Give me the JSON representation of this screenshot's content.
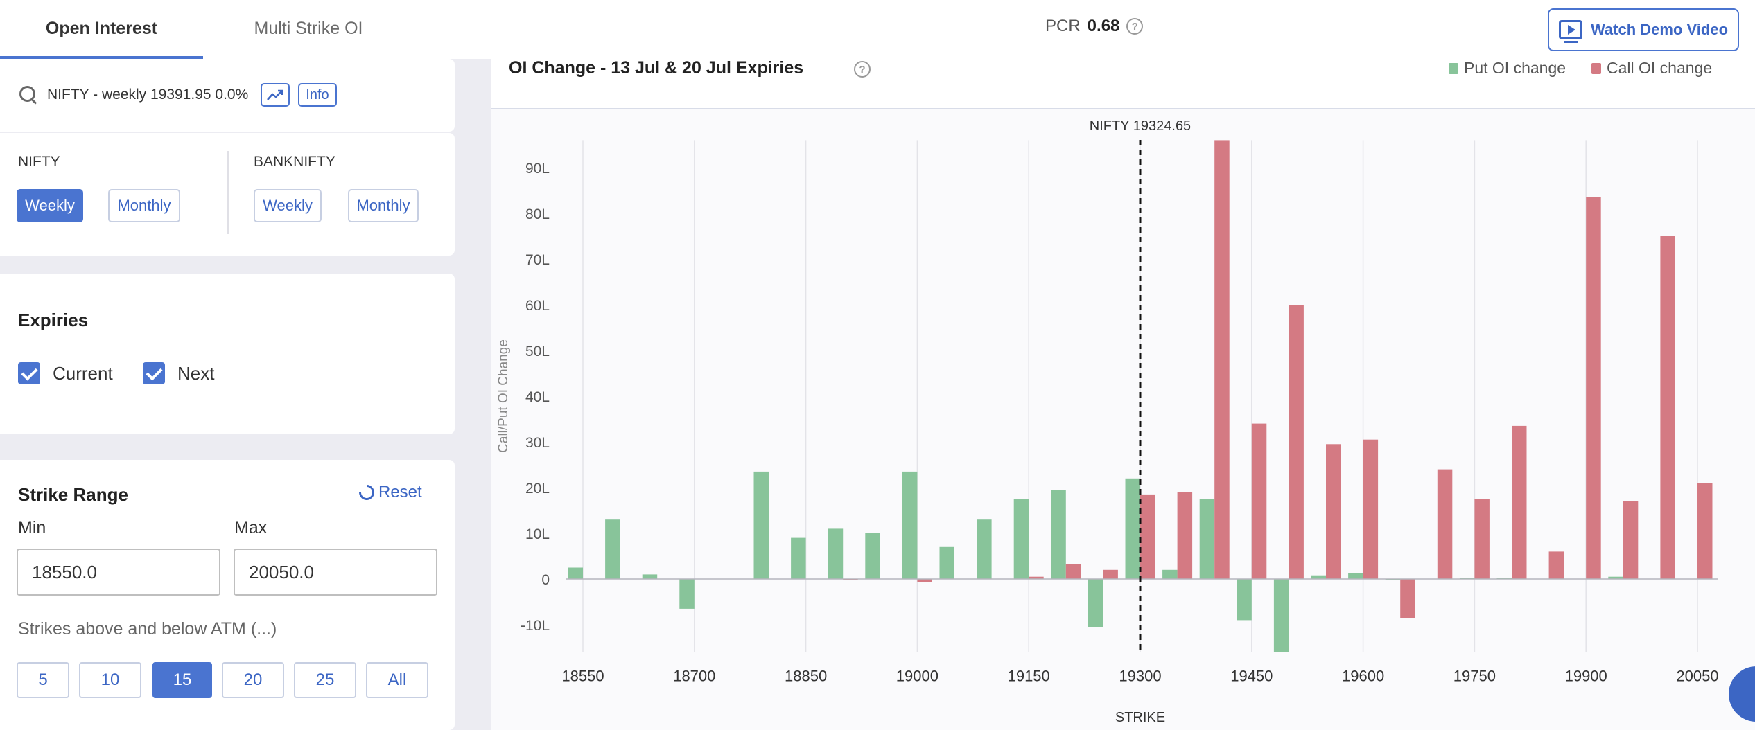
{
  "tabs": [
    {
      "label": "Open Interest",
      "active": true
    },
    {
      "label": "Multi Strike OI",
      "active": false
    }
  ],
  "pcr": {
    "label": "PCR",
    "value": "0.68"
  },
  "demo_button": {
    "label": "Watch Demo Video",
    "icon": "play-video-icon"
  },
  "search": {
    "text": "NIFTY - weekly 19391.95 0.0%",
    "info_label": "Info",
    "icons": [
      "search-icon",
      "trend-chart-icon"
    ]
  },
  "index_selector": {
    "nifty": {
      "label": "NIFTY",
      "options": [
        "Weekly",
        "Monthly"
      ],
      "selected": "Weekly"
    },
    "banknifty": {
      "label": "BANKNIFTY",
      "options": [
        "Weekly",
        "Monthly"
      ],
      "selected": null
    }
  },
  "expiries": {
    "title": "Expiries",
    "options": [
      {
        "label": "Current",
        "checked": true
      },
      {
        "label": "Next",
        "checked": true
      }
    ]
  },
  "strike_range": {
    "title": "Strike Range",
    "reset_label": "Reset",
    "min_label": "Min",
    "min_value": "18550.0",
    "max_label": "Max",
    "max_value": "20050.0",
    "strikes_label": "Strikes above and below ATM (...)",
    "strike_options": [
      "5",
      "10",
      "15",
      "20",
      "25",
      "All"
    ],
    "selected": "15"
  },
  "colors": {
    "accent": "#4a74d0",
    "put": "#88c49a",
    "call": "#d47a83"
  },
  "chart": {
    "title": "OI Change - 13 Jul & 20 Jul Expiries",
    "legend": [
      {
        "label": "Put OI change",
        "color": "#88c49a"
      },
      {
        "label": "Call OI change",
        "color": "#d47a83"
      }
    ]
  },
  "chart_data": {
    "type": "bar",
    "title": "OI Change - 13 Jul & 20 Jul Expiries",
    "xlabel": "STRIKE",
    "ylabel": "Call/Put OI Change",
    "spot_label": "NIFTY 19324.65",
    "spot_strike": 19300,
    "ylim": [
      -16,
      96
    ],
    "yticks": [
      -10,
      0,
      10,
      20,
      30,
      40,
      50,
      60,
      70,
      80,
      90
    ],
    "ytick_labels": [
      "-10L",
      "0",
      "10L",
      "20L",
      "30L",
      "40L",
      "50L",
      "60L",
      "70L",
      "80L",
      "90L"
    ],
    "xtick_labels": [
      "18550",
      "18700",
      "18850",
      "19000",
      "19150",
      "19300",
      "19450",
      "19600",
      "19750",
      "19900",
      "20050"
    ],
    "categories": [
      18550,
      18600,
      18650,
      18700,
      18750,
      18800,
      18850,
      18900,
      18950,
      19000,
      19050,
      19100,
      19150,
      19200,
      19250,
      19300,
      19350,
      19400,
      19450,
      19500,
      19550,
      19600,
      19650,
      19700,
      19750,
      19800,
      19850,
      19900,
      19950,
      20000,
      20050
    ],
    "series": [
      {
        "name": "Put OI change",
        "color": "#88c49a",
        "values": [
          2.5,
          13,
          1,
          -6.5,
          0,
          23.5,
          9,
          11,
          10,
          23.5,
          7,
          13,
          17.5,
          19.5,
          -10.5,
          22,
          2,
          17.5,
          -9,
          -16,
          0.8,
          1.3,
          -0.3,
          0,
          0.3,
          0.3,
          0,
          0,
          0.5,
          0,
          0
        ]
      },
      {
        "name": "Call OI change",
        "color": "#d47a83",
        "values": [
          0,
          0,
          0,
          0,
          0,
          0,
          0,
          -0.3,
          0,
          -0.7,
          0,
          0,
          0.5,
          3.2,
          2,
          18.5,
          19,
          96,
          34,
          60,
          29.5,
          30.5,
          -8.5,
          24,
          17.5,
          33.5,
          6,
          83.5,
          17,
          75,
          21
        ]
      }
    ]
  }
}
